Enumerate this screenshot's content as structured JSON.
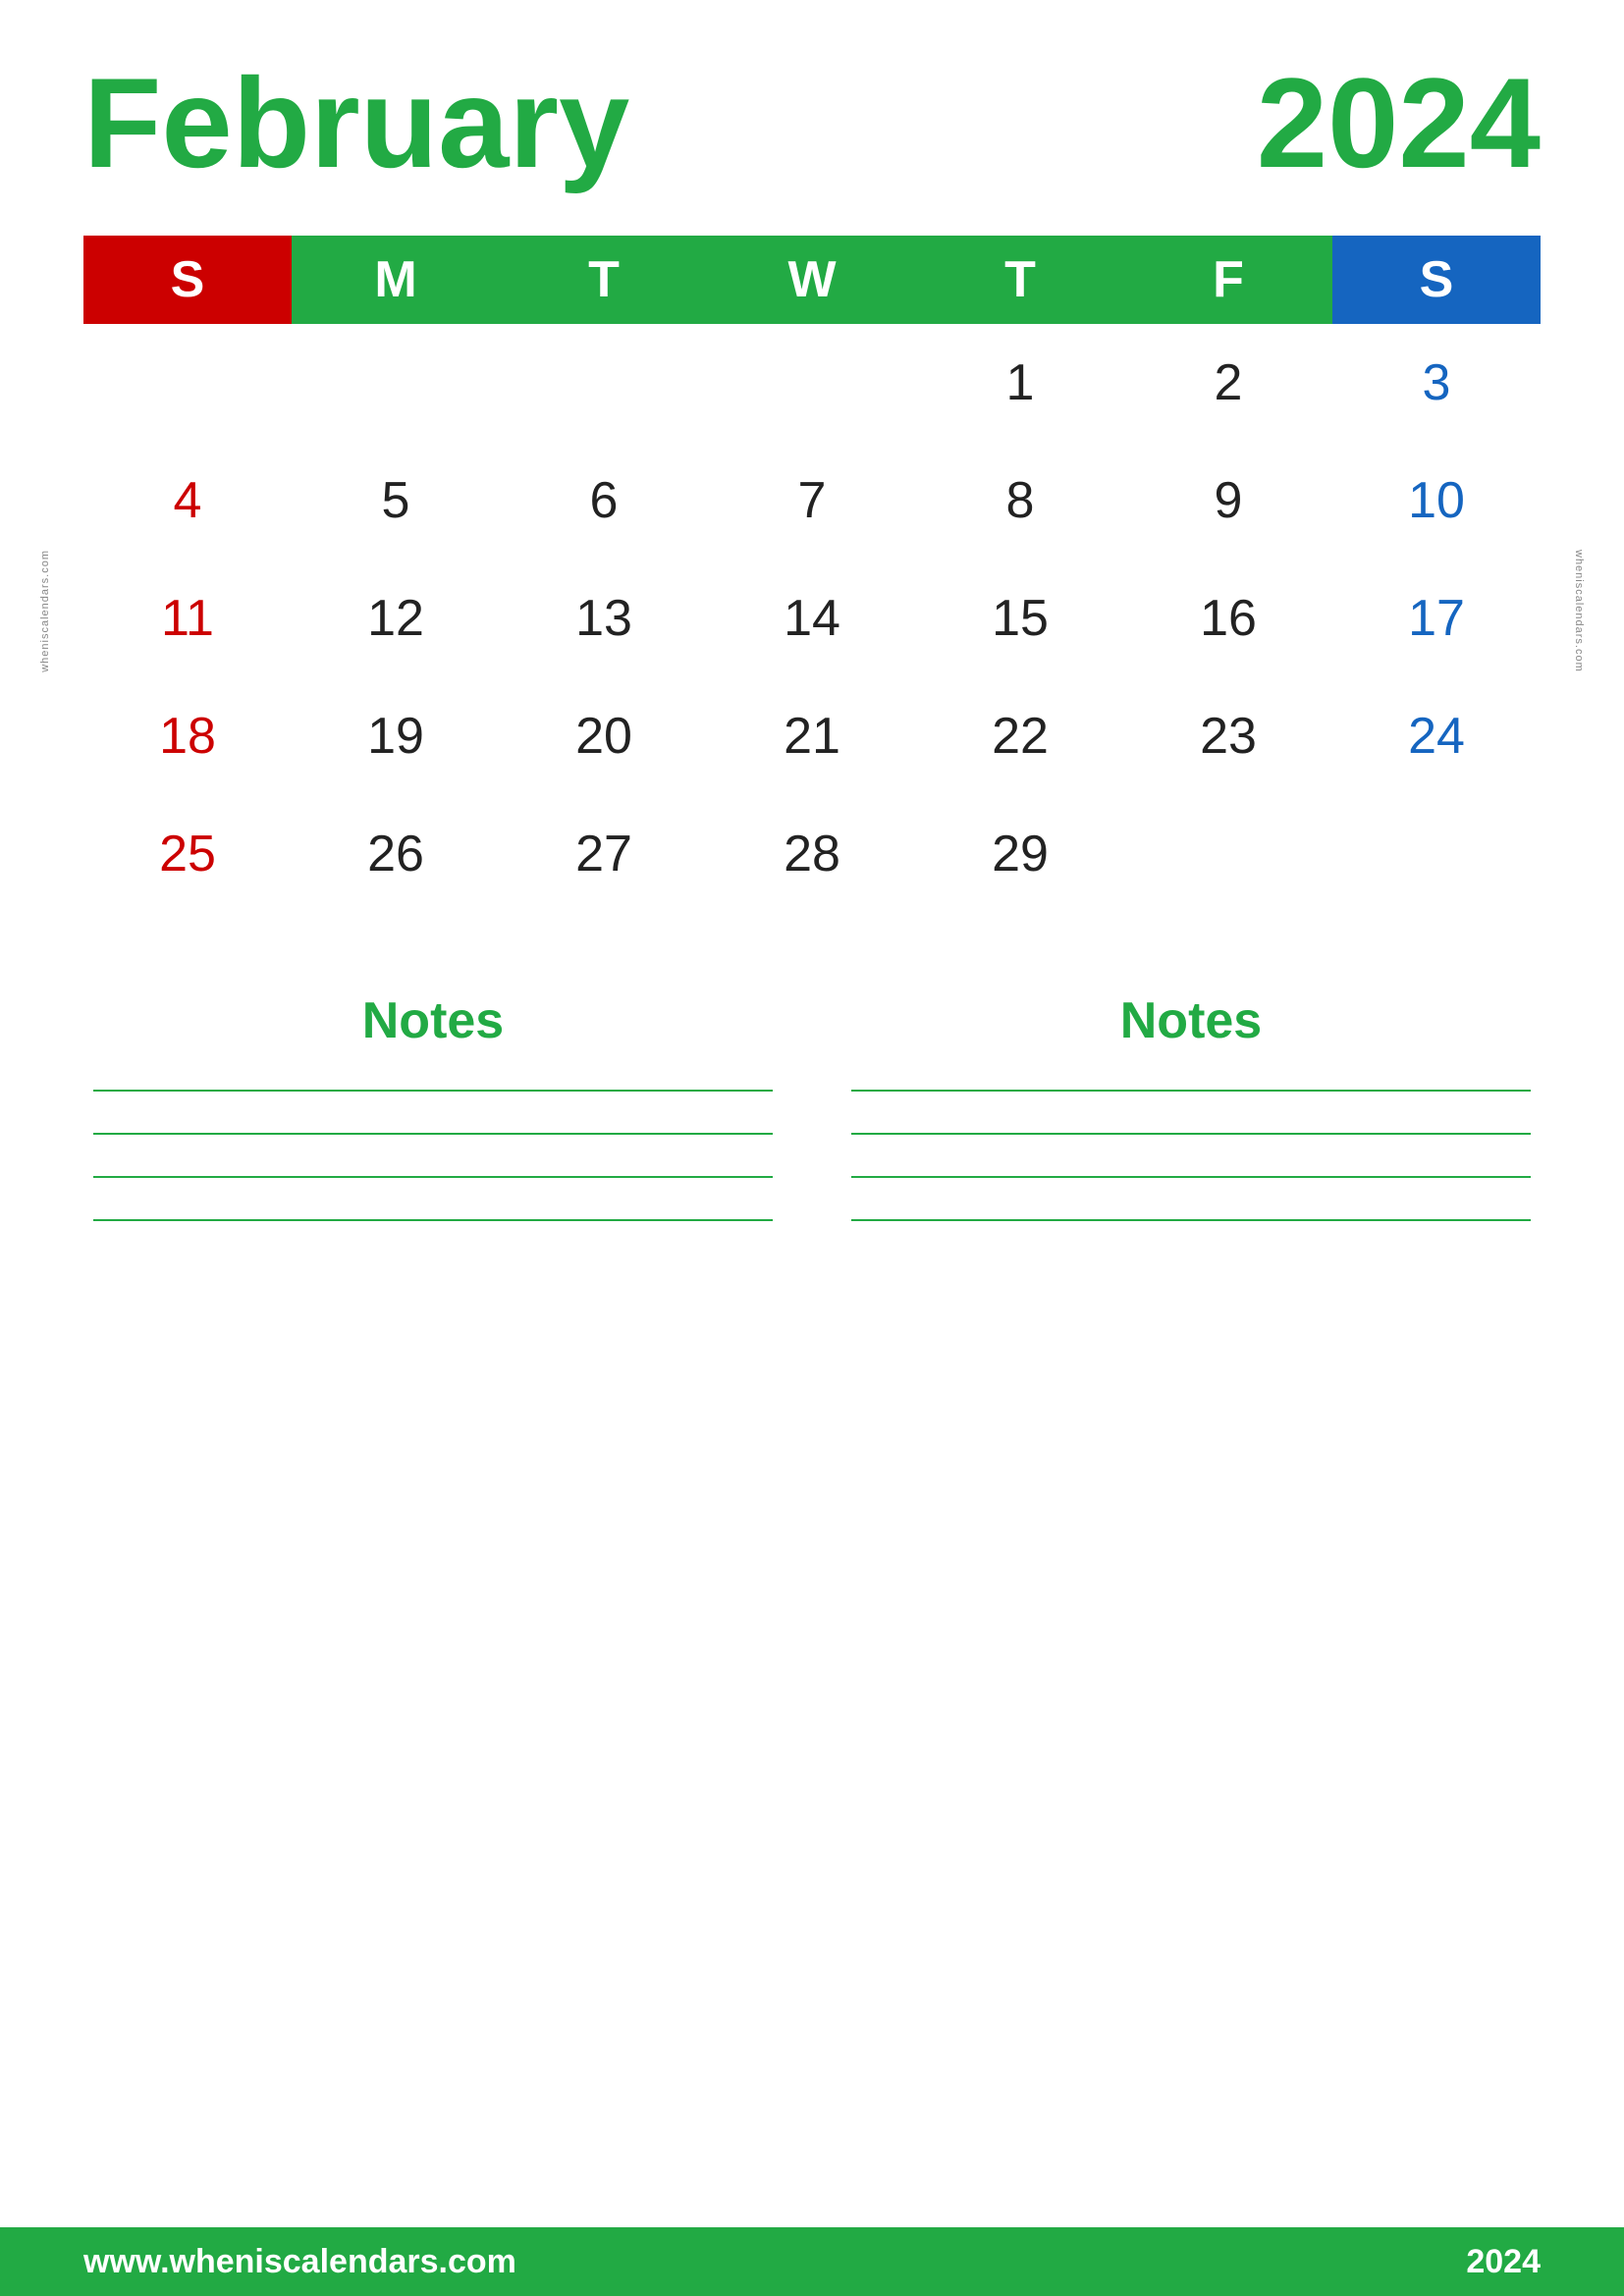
{
  "header": {
    "month": "February",
    "year": "2024"
  },
  "calendar": {
    "days_header": [
      "S",
      "M",
      "T",
      "W",
      "T",
      "F",
      "S"
    ],
    "days_header_types": [
      "sunday",
      "weekday",
      "weekday",
      "weekday",
      "weekday",
      "weekday",
      "saturday"
    ],
    "weeks": [
      [
        "",
        "",
        "",
        "",
        "1",
        "2",
        "3"
      ],
      [
        "4",
        "5",
        "6",
        "7",
        "8",
        "9",
        "10"
      ],
      [
        "11",
        "12",
        "13",
        "14",
        "15",
        "16",
        "17"
      ],
      [
        "18",
        "19",
        "20",
        "21",
        "22",
        "23",
        "24"
      ],
      [
        "25",
        "26",
        "27",
        "28",
        "29",
        "",
        ""
      ]
    ],
    "sunday_dates": [
      "4",
      "11",
      "18",
      "25"
    ],
    "saturday_dates": [
      "3",
      "10",
      "17",
      "24"
    ]
  },
  "notes": {
    "left_title": "Notes",
    "right_title": "Notes",
    "lines_count": 4
  },
  "footer": {
    "url": "www.wheniscalendars.com",
    "year": "2024"
  },
  "watermark": "wheniscalendars.com"
}
